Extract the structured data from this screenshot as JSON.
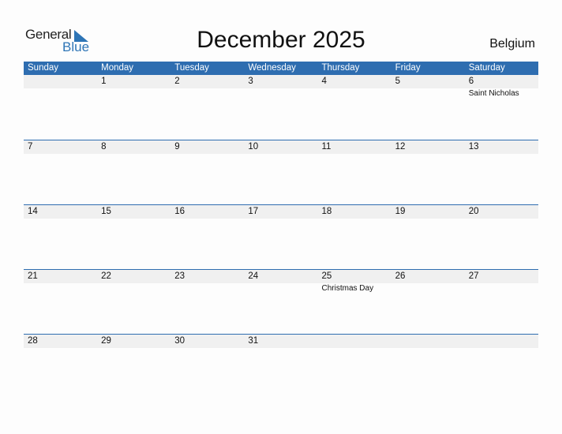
{
  "logo": {
    "line1": "General",
    "line2": "Blue"
  },
  "title": "December 2025",
  "country": "Belgium",
  "colors": {
    "accent": "#2e6db0",
    "row_strip": "#f0f0f0"
  },
  "weekdays": [
    "Sunday",
    "Monday",
    "Tuesday",
    "Wednesday",
    "Thursday",
    "Friday",
    "Saturday"
  ],
  "weeks": [
    [
      {
        "d": ""
      },
      {
        "d": "1"
      },
      {
        "d": "2"
      },
      {
        "d": "3"
      },
      {
        "d": "4"
      },
      {
        "d": "5"
      },
      {
        "d": "6",
        "h": "Saint Nicholas"
      }
    ],
    [
      {
        "d": "7"
      },
      {
        "d": "8"
      },
      {
        "d": "9"
      },
      {
        "d": "10"
      },
      {
        "d": "11"
      },
      {
        "d": "12"
      },
      {
        "d": "13"
      }
    ],
    [
      {
        "d": "14"
      },
      {
        "d": "15"
      },
      {
        "d": "16"
      },
      {
        "d": "17"
      },
      {
        "d": "18"
      },
      {
        "d": "19"
      },
      {
        "d": "20"
      }
    ],
    [
      {
        "d": "21"
      },
      {
        "d": "22"
      },
      {
        "d": "23"
      },
      {
        "d": "24"
      },
      {
        "d": "25",
        "h": "Christmas Day"
      },
      {
        "d": "26"
      },
      {
        "d": "27"
      }
    ],
    [
      {
        "d": "28"
      },
      {
        "d": "29"
      },
      {
        "d": "30"
      },
      {
        "d": "31"
      },
      {
        "d": ""
      },
      {
        "d": ""
      },
      {
        "d": ""
      }
    ]
  ]
}
